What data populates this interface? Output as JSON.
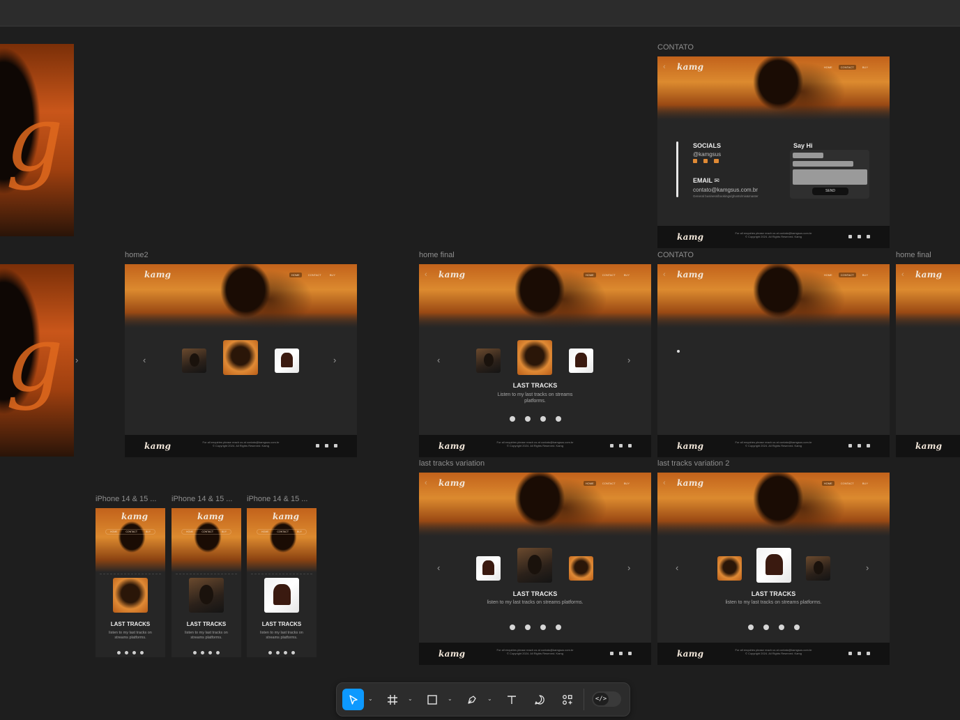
{
  "frames": {
    "home2": "home2",
    "home_final": "home final",
    "contato_top": "CONTATO",
    "contato_mid": "CONTATO",
    "home_final_right": "home final",
    "last_tracks_variation": "last tracks variation",
    "last_tracks_variation_2": "last tracks variation 2",
    "iphone_1": "iPhone 14 & 15 ...",
    "iphone_2": "iPhone 14 & 15 ...",
    "iphone_3": "iPhone 14 & 15 ..."
  },
  "site": {
    "logo": "kamg",
    "nav": [
      "HOME",
      "CONTACT",
      "BUY"
    ],
    "last_tracks_title": "LAST TRACKS",
    "last_tracks_sub_a": "Listen to my last tracks on streams platforms.",
    "last_tracks_sub_b": "listen to my last tracks on streams platforms.",
    "footer_text": "For all enquiries please reach us at contato@kamgsus.com.br",
    "footer_copy": "© Copyright 2024. All Rights Reserved. Kamg"
  },
  "contato": {
    "socials_title": "SOCIALS",
    "socials_handle": "@kamgsus",
    "email_title": "EMAIL",
    "email_address": "contato@kamgsus.com.br",
    "email_note": "General business/bookings/ghosts/mix&master",
    "say_hi": "Say Hi",
    "send": "SEND"
  },
  "toolbar": {
    "tools": [
      "move-tool",
      "frame-tool",
      "shape-tool",
      "pen-tool",
      "text-tool",
      "comment-tool",
      "actions-tool",
      "dev-mode-toggle"
    ],
    "active": "move-tool"
  }
}
